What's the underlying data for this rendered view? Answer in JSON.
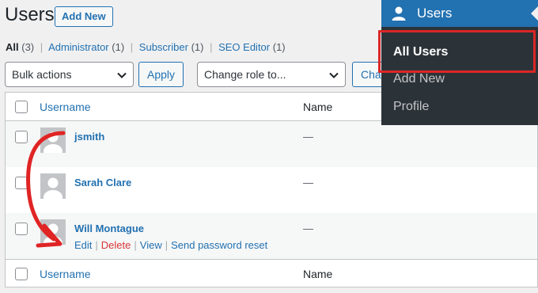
{
  "header": {
    "title": "Users",
    "add_new": "Add New"
  },
  "filters": {
    "all": "All",
    "all_count": "(3)",
    "administrator": "Administrator",
    "administrator_count": "(1)",
    "subscriber": "Subscriber",
    "subscriber_count": "(1)",
    "seo_editor": "SEO Editor",
    "seo_editor_count": "(1)",
    "separator": "|"
  },
  "toolbar": {
    "bulk_actions": "Bulk actions",
    "apply": "Apply",
    "change_role": "Change role to...",
    "change_partial": "Chan"
  },
  "table": {
    "columns": {
      "username": "Username",
      "name": "Name"
    },
    "rows": [
      {
        "username": "jsmith",
        "name": "—"
      },
      {
        "username": "Sarah Clare",
        "name": "—"
      },
      {
        "username": "Will Montague",
        "name": "—"
      }
    ],
    "row_actions": {
      "edit": "Edit",
      "delete": "Delete",
      "view": "View",
      "send_password_reset": "Send password reset",
      "separator": "|"
    }
  },
  "admin_menu": {
    "title": "Users",
    "items": [
      "All Users",
      "Add New",
      "Profile"
    ],
    "current": "All Users"
  },
  "colors": {
    "accent": "#2271b1",
    "menu_bg": "#2c3338",
    "highlight": "#dc2626",
    "delete": "#d63638"
  },
  "icons": {
    "menu": "users-icon",
    "dropdown": "chevron-down-icon",
    "avatar": "avatar-placeholder-icon",
    "annotation": "curved-arrow-icon"
  }
}
